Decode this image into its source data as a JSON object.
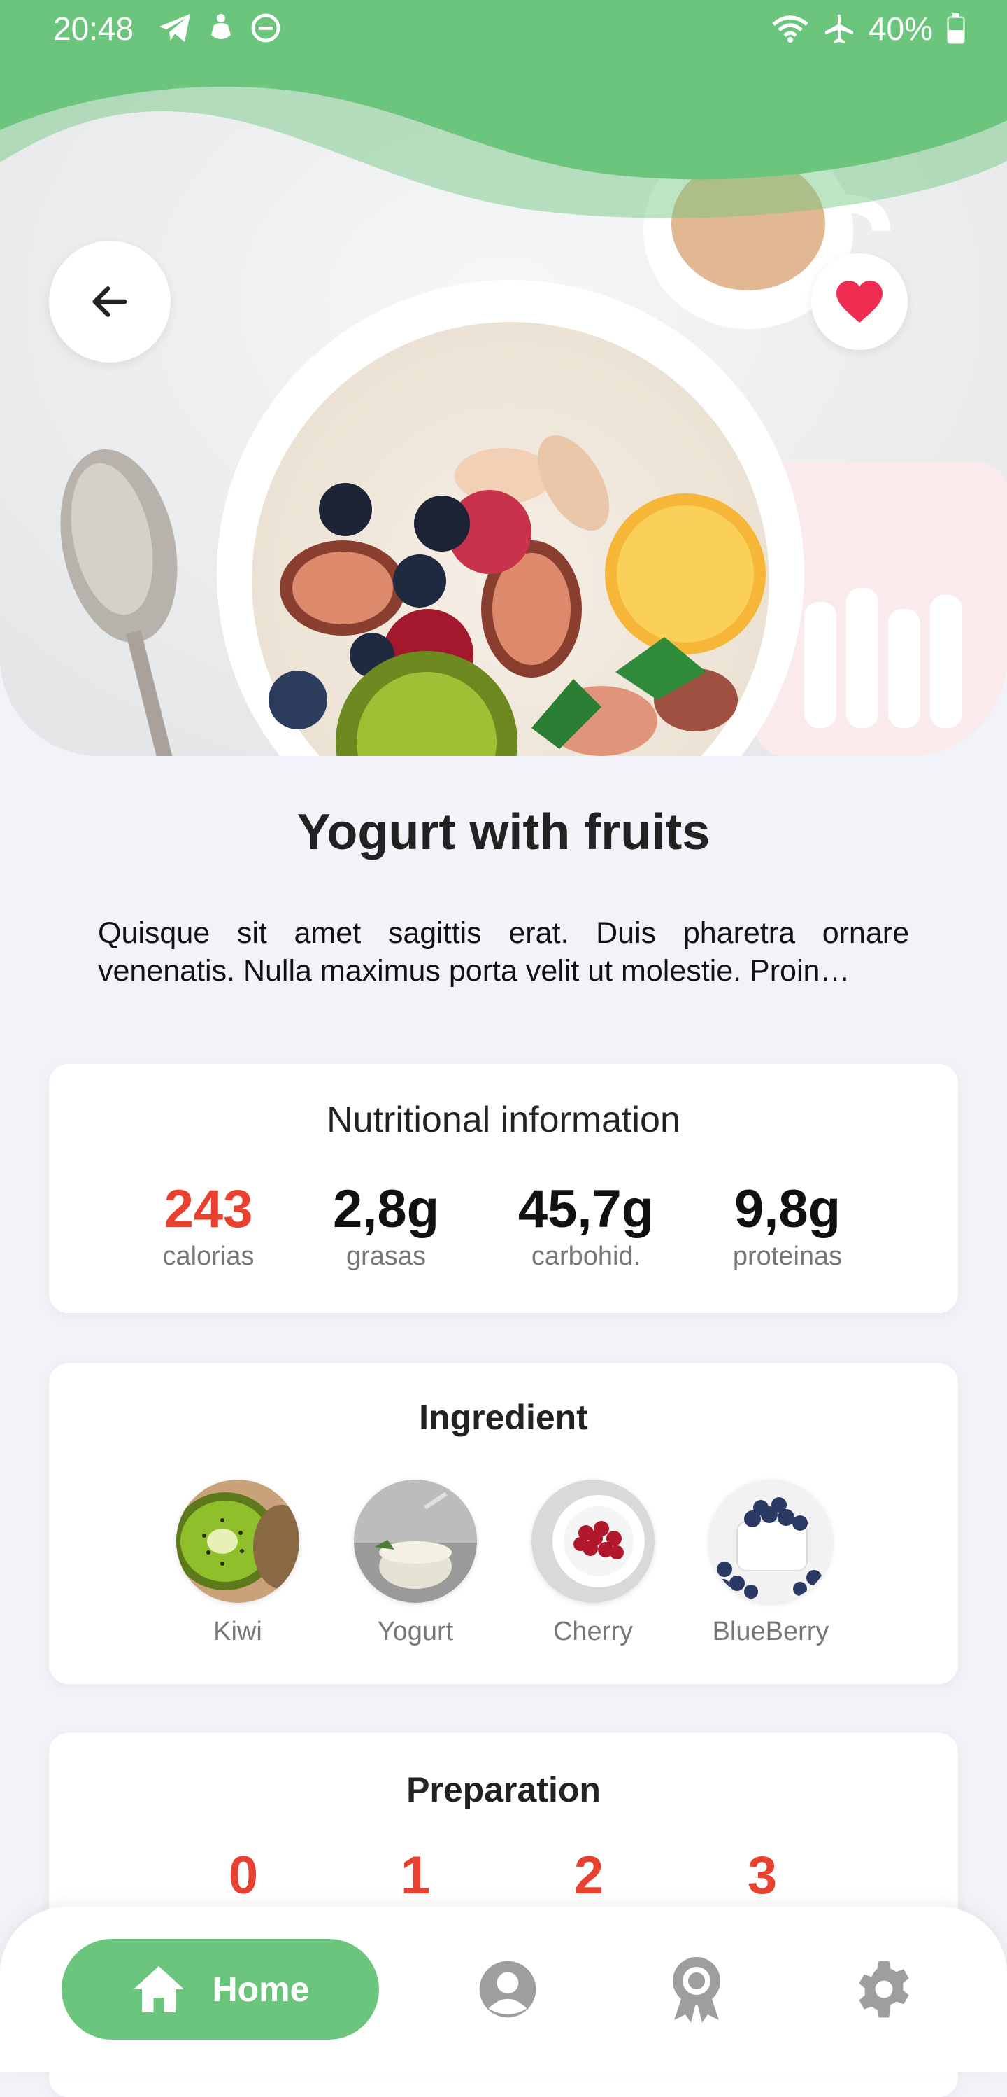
{
  "status_bar": {
    "time": "20:48",
    "battery": "40%",
    "left_icons": [
      "telegram-icon",
      "hand-icon",
      "do-not-disturb-icon"
    ],
    "right_icons": [
      "wifi-icon",
      "airplane-icon",
      "battery-icon"
    ]
  },
  "hero": {
    "back_icon": "arrow-left-icon",
    "favorite_icon": "heart-icon"
  },
  "recipe": {
    "title": "Yogurt with fruits",
    "description": "Quisque sit amet sagittis erat. Duis pharetra ornare venenatis. Nulla maximus porta velit ut molestie. Proin…"
  },
  "nutrition": {
    "title": "Nutritional information",
    "items": [
      {
        "value": "243",
        "label": "calorias"
      },
      {
        "value": "2,8g",
        "label": "grasas"
      },
      {
        "value": "45,7g",
        "label": "carbohid."
      },
      {
        "value": "9,8g",
        "label": "proteinas"
      }
    ]
  },
  "ingredients": {
    "title": "Ingredient",
    "items": [
      {
        "label": "Kiwi"
      },
      {
        "label": "Yogurt"
      },
      {
        "label": "Cherry"
      },
      {
        "label": "BlueBerry"
      }
    ]
  },
  "preparation": {
    "title": "Preparation",
    "steps": [
      "0",
      "1",
      "2",
      "3"
    ]
  },
  "bottom_nav": {
    "home_label": "Home",
    "icons": [
      "home-icon",
      "profile-icon",
      "award-icon",
      "settings-icon"
    ]
  },
  "colors": {
    "primary_green": "#6CC57C",
    "accent_red": "#E8412F",
    "heart_red": "#EF2D52",
    "background": "#F2F3F8",
    "icon_gray": "#9E9E9E"
  }
}
